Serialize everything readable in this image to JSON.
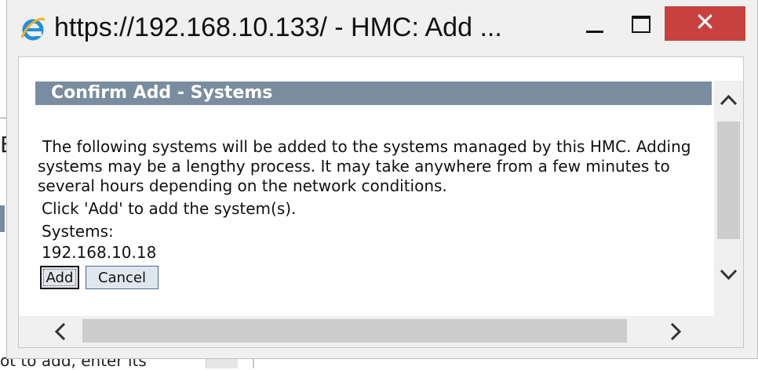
{
  "window": {
    "title": "https://192.168.10.133/ - HMC: Add ...",
    "controls": {
      "minimize_icon": "minimize-icon",
      "maximize_icon": "maximize-icon",
      "close_glyph": "✕"
    },
    "close_color": "#c8413e"
  },
  "background": {
    "left_glyph": "B",
    "bottom_text": "ot to add, enter its"
  },
  "dialog": {
    "header": "Confirm Add - Systems",
    "header_color": "#7a8c9f",
    "message_lines": [
      "The following systems will be added to the systems managed by this HMC. Adding",
      "systems may be a lengthy process. It may take anywhere from a few minutes to",
      "several hours depending on the network conditions."
    ],
    "instruction": "Click 'Add' to add the system(s).",
    "systems_label": "Systems:",
    "systems": [
      "192.168.10.18"
    ],
    "add_label": "Add",
    "cancel_label": "Cancel"
  }
}
